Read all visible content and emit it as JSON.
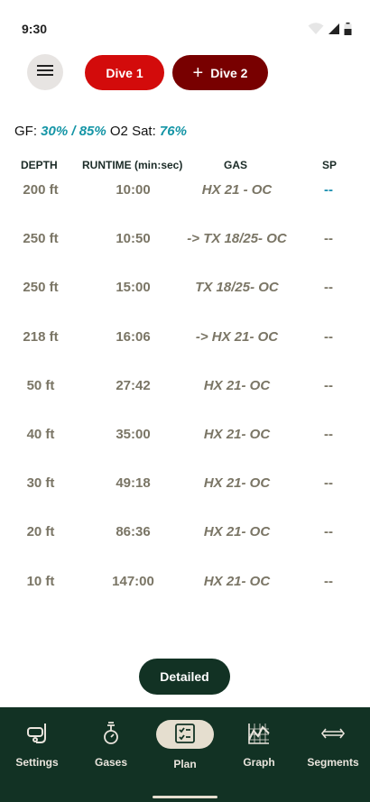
{
  "status_bar": {
    "time": "9:30",
    "icons": [
      "wifi-icon",
      "signal-icon",
      "battery-icon"
    ]
  },
  "header": {
    "menu_icon": "hamburger-menu-icon",
    "dive1_label": "Dive 1",
    "dive2_label": "Dive 2",
    "dive2_icon": "plus-icon",
    "colors": {
      "dive1": "#d30b0b",
      "dive2": "#780000"
    }
  },
  "summary": {
    "gf_label": "GF:",
    "gf_value": "30% / 85%",
    "o2_label": "O2 Sat:",
    "o2_value": "76%"
  },
  "table": {
    "headers": {
      "depth": "DEPTH",
      "runtime": "RUNTIME (min:sec)",
      "gas": "GAS",
      "sp": "SP"
    },
    "rows": [
      {
        "depth": "200 ft",
        "runtime": "10:00",
        "gas": "HX 21 - OC",
        "sp": "--"
      },
      {
        "depth": "250 ft",
        "runtime": "10:50",
        "gas": "-> TX 18/25- OC",
        "sp": "--"
      },
      {
        "depth": "250 ft",
        "runtime": "15:00",
        "gas": "TX 18/25- OC",
        "sp": "--"
      },
      {
        "depth": "218 ft",
        "runtime": "16:06",
        "gas": "-> HX 21- OC",
        "sp": "--"
      },
      {
        "depth": "50 ft",
        "runtime": "27:42",
        "gas": "HX 21- OC",
        "sp": "--"
      },
      {
        "depth": "40 ft",
        "runtime": "35:00",
        "gas": "HX 21- OC",
        "sp": "--"
      },
      {
        "depth": "30 ft",
        "runtime": "49:18",
        "gas": "HX 21- OC",
        "sp": "--"
      },
      {
        "depth": "20 ft",
        "runtime": "86:36",
        "gas": "HX 21- OC",
        "sp": "--"
      },
      {
        "depth": "10 ft",
        "runtime": "147:00",
        "gas": "HX 21- OC",
        "sp": "--"
      }
    ]
  },
  "detailed_button": "Detailed",
  "bottom_nav": {
    "items": [
      {
        "label": "Settings",
        "icon": "snorkel-mask-icon"
      },
      {
        "label": "Gases",
        "icon": "gas-tank-icon"
      },
      {
        "label": "Plan",
        "icon": "checklist-icon",
        "active": true
      },
      {
        "label": "Graph",
        "icon": "graph-icon"
      },
      {
        "label": "Segments",
        "icon": "double-arrow-icon"
      }
    ]
  },
  "colors": {
    "accent": "#1595a6",
    "nav_bg": "#123224",
    "active_pill": "#e5decf",
    "value_text": "#7a7565"
  }
}
